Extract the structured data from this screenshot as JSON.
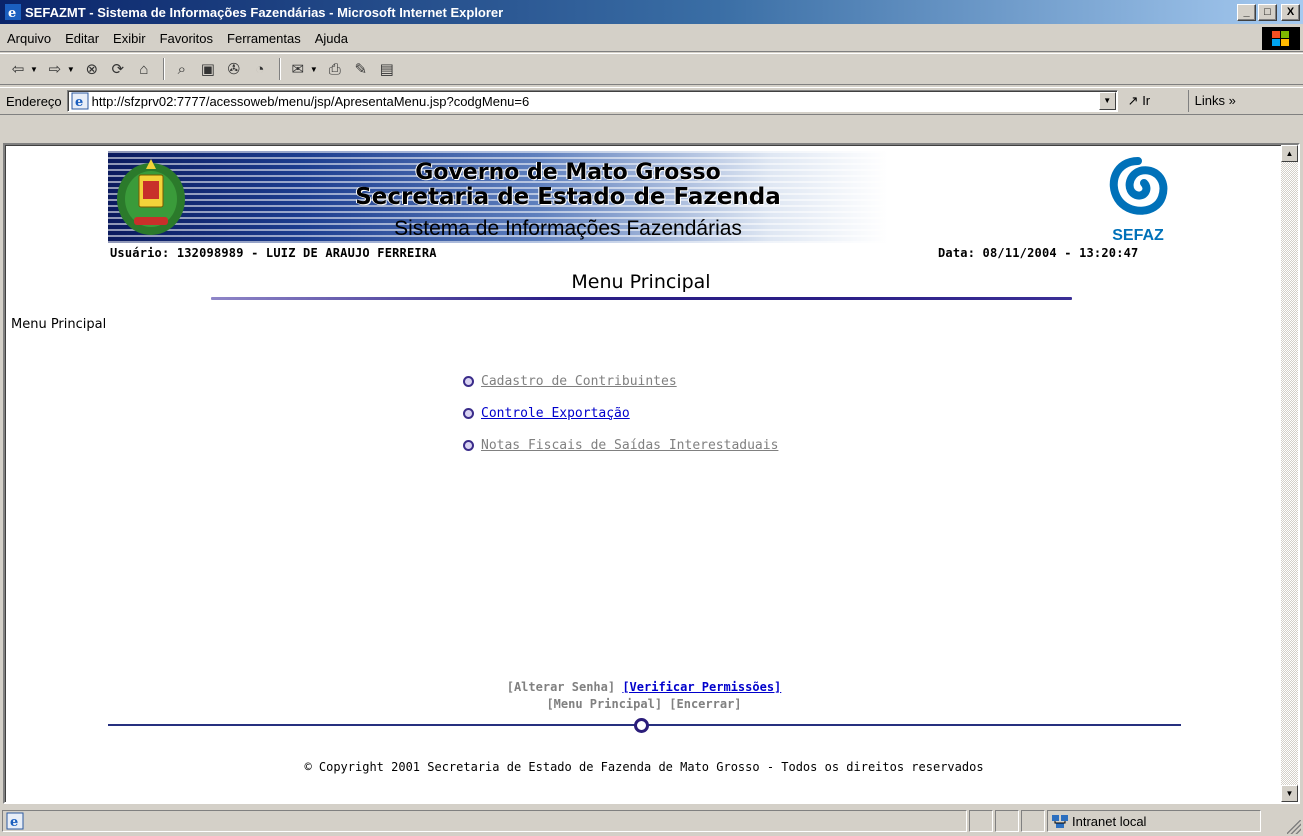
{
  "window": {
    "title": "SEFAZMT - Sistema de Informações Fazendárias - Microsoft Internet Explorer",
    "minimize": "_",
    "maximize": "□",
    "close": "X"
  },
  "menubar": {
    "items": [
      "Arquivo",
      "Editar",
      "Exibir",
      "Favoritos",
      "Ferramentas",
      "Ajuda"
    ]
  },
  "toolbar": {
    "buttons": [
      "back-icon",
      "forward-icon",
      "stop-icon",
      "refresh-icon",
      "home-icon",
      "search-icon",
      "favorites-icon",
      "media-icon",
      "history-icon",
      "mail-icon",
      "print-icon",
      "edit-icon",
      "discuss-icon"
    ]
  },
  "address": {
    "label": "Endereço",
    "url": "http://sfzprv02:7777/acessoweb/menu/jsp/ApresentaMenu.jsp?codgMenu=6",
    "go_label": "Ir",
    "links_label": "Links »"
  },
  "header": {
    "gov_line1": "Governo de Mato Grosso",
    "gov_line2": "Secretaria de Estado de Fazenda",
    "system_name": "Sistema de Informações Fazendárias",
    "logo_label": "SEFAZ",
    "user": "Usuário: 132098989 - LUIZ DE ARAUJO FERREIRA",
    "date": "Data: 08/11/2004 - 13:20:47"
  },
  "page": {
    "title": "Menu Principal",
    "breadcrumb": "Menu Principal",
    "menu_links": [
      {
        "label": "Cadastro de Contribuintes",
        "active": false
      },
      {
        "label": "Controle Exportação",
        "active": true
      },
      {
        "label": "Notas Fiscais de Saídas Interestaduais",
        "active": false
      }
    ]
  },
  "footer": {
    "alterar_senha": "[Alterar Senha]",
    "verificar_permissoes": "[Verificar Permissões]",
    "menu_principal": "[Menu Principal]",
    "encerrar": "[Encerrar]",
    "copyright": "© Copyright 2001 Secretaria de Estado de Fazenda de Mato Grosso - Todos os direitos reservados"
  },
  "statusbar": {
    "zone": "Intranet local"
  },
  "colors": {
    "link_active": "#0000cc",
    "link_visited": "#808080",
    "rule": "#2a1e86",
    "sefaz_blue": "#0071b9"
  }
}
